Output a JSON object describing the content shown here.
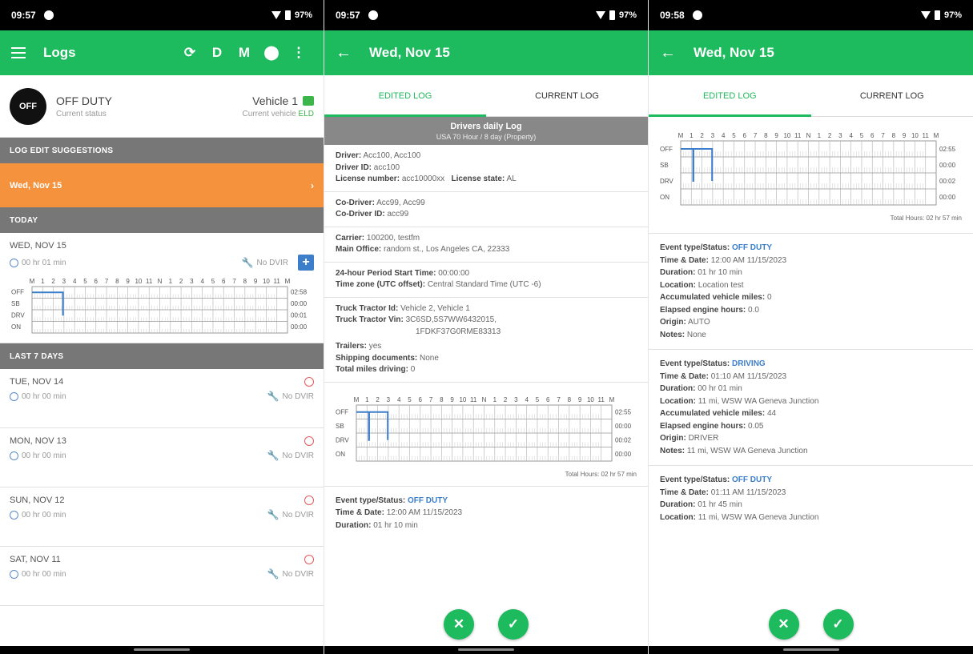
{
  "colors": {
    "accent": "#1eba5e",
    "suggestion": "#f5923e",
    "section": "#777777",
    "blue": "#3c7ec9",
    "alert": "#e65a5a"
  },
  "panel1": {
    "status_bar": {
      "time": "09:57",
      "battery": "97%"
    },
    "app_bar": {
      "title": "Logs",
      "btn_d": "D",
      "btn_m": "M",
      "menu": "⋮"
    },
    "status": {
      "badge": "OFF",
      "main": "OFF DUTY",
      "sub": "Current status",
      "vehicle": "Vehicle 1",
      "vehicle_sub": "Current vehicle",
      "eld": "ELD"
    },
    "suggestions_header": "LOG EDIT SUGGESTIONS",
    "suggestion_item": "Wed, Nov 15",
    "today_header": "TODAY",
    "today": {
      "date": "WED, NOV 15",
      "duration": "00 hr 01 min",
      "dvir": "No DVIR"
    },
    "last7_header": "LAST 7 DAYS",
    "days": [
      {
        "date": "TUE, NOV 14",
        "duration": "00 hr 00 min",
        "dvir": "No DVIR"
      },
      {
        "date": "MON, NOV 13",
        "duration": "00 hr 00 min",
        "dvir": "No DVIR"
      },
      {
        "date": "SUN, NOV 12",
        "duration": "00 hr 00 min",
        "dvir": "No DVIR"
      },
      {
        "date": "SAT, NOV 11",
        "duration": "00 hr 00 min",
        "dvir": "No DVIR"
      }
    ],
    "grid_hours": [
      "02:58",
      "00:00",
      "00:01",
      "00:00"
    ]
  },
  "panel2": {
    "status_bar": {
      "time": "09:57",
      "battery": "97%"
    },
    "app_bar": {
      "title": "Wed, Nov 15"
    },
    "tabs": {
      "edited": "EDITED LOG",
      "current": "CURRENT LOG"
    },
    "daily_log": {
      "title": "Drivers daily Log",
      "subtitle": "USA 70 Hour / 8 day (Property)"
    },
    "driver": {
      "driver": "Acc100, Acc100",
      "driver_id": "acc100",
      "license_number": "acc10000xx",
      "license_state": "AL"
    },
    "codriver": {
      "codriver": "Acc99, Acc99",
      "codriver_id": "acc99"
    },
    "carrier": {
      "carrier": "100200, testfm",
      "main_office": "random st., Los Angeles CA, 22333"
    },
    "period": {
      "start": "00:00:00",
      "timezone": "Central Standard Time (UTC -6)"
    },
    "truck": {
      "tractor_id": "Vehicle 2, Vehicle 1",
      "tractor_vin": "3C6SD,5S7WW6432015,",
      "tractor_vin2": "1FDKF37G0RME83313",
      "trailers": "yes",
      "shipping": "None",
      "total_miles": "0"
    },
    "grid_hours": [
      "02:55",
      "00:00",
      "00:02",
      "00:00"
    ],
    "total_hours": "Total Hours: 02 hr 57 min",
    "event": {
      "status": "OFF DUTY",
      "time": "12:00 AM 11/15/2023",
      "duration": "01 hr 10 min"
    },
    "labels": {
      "driver": "Driver:",
      "driver_id": "Driver ID:",
      "license_number": "License number:",
      "license_state": "License state:",
      "codriver": "Co-Driver:",
      "codriver_id": "Co-Driver ID:",
      "carrier": "Carrier:",
      "main_office": "Main Office:",
      "period": "24-hour Period Start Time:",
      "timezone": "Time zone (UTC offset):",
      "tractor_id": "Truck Tractor Id:",
      "tractor_vin": "Truck Tractor Vin:",
      "trailers": "Trailers:",
      "shipping": "Shipping documents:",
      "total_miles": "Total miles driving:",
      "event_type": "Event type/Status:",
      "time_date": "Time & Date:",
      "duration": "Duration:"
    }
  },
  "panel3": {
    "status_bar": {
      "time": "09:58",
      "battery": "97%"
    },
    "app_bar": {
      "title": "Wed, Nov 15"
    },
    "tabs": {
      "edited": "EDITED LOG",
      "current": "CURRENT LOG"
    },
    "grid_hours": [
      "02:55",
      "00:00",
      "00:02",
      "00:00"
    ],
    "total_hours": "Total Hours: 02 hr 57 min",
    "events": [
      {
        "status": "OFF DUTY",
        "time": "12:00 AM 11/15/2023",
        "duration": "01 hr 10 min",
        "location": "Location test",
        "miles": "0",
        "engine": "0.0",
        "origin": "AUTO",
        "notes": "None"
      },
      {
        "status": "DRIVING",
        "time": "01:10 AM 11/15/2023",
        "duration": "00 hr 01 min",
        "location": "11 mi, WSW WA Geneva Junction",
        "miles": "44",
        "engine": "0.05",
        "origin": "DRIVER",
        "notes": "11 mi, WSW WA Geneva Junction"
      },
      {
        "status": "OFF DUTY",
        "time": "01:11 AM 11/15/2023",
        "duration": "01 hr 45 min",
        "location": "11 mi, WSW WA Geneva Junction"
      }
    ],
    "labels": {
      "event_type": "Event type/Status:",
      "time_date": "Time & Date:",
      "duration": "Duration:",
      "location": "Location:",
      "miles": "Accumulated vehicle miles:",
      "engine": "Elapsed engine hours:",
      "origin": "Origin:",
      "notes": "Notes:"
    }
  },
  "grid": {
    "hour_labels": [
      "M",
      "1",
      "2",
      "3",
      "4",
      "5",
      "6",
      "7",
      "8",
      "9",
      "10",
      "11",
      "N",
      "1",
      "2",
      "3",
      "4",
      "5",
      "6",
      "7",
      "8",
      "9",
      "10",
      "11",
      "M"
    ],
    "row_labels": [
      "OFF",
      "SB",
      "DRV",
      "ON"
    ]
  }
}
